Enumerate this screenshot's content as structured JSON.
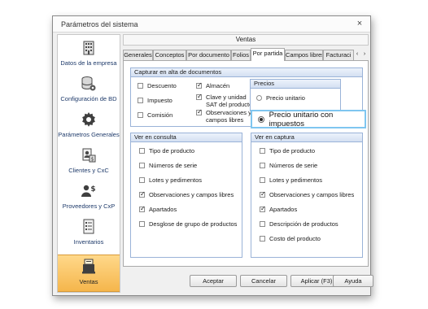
{
  "window": {
    "title": "Parámetros del sistema",
    "close": "×"
  },
  "sidebar": {
    "items": [
      {
        "label": "Datos de la empresa",
        "icon": "building-icon"
      },
      {
        "label": "Configuración de BD",
        "icon": "database-gear-icon"
      },
      {
        "label": "Parámetros Generales",
        "icon": "gear-icon"
      },
      {
        "label": "Clientes y CxC",
        "icon": "clients-document-icon"
      },
      {
        "label": "Proveedores y CxP",
        "icon": "supplier-money-icon"
      },
      {
        "label": "Inventarios",
        "icon": "inventory-list-icon"
      },
      {
        "label": "Ventas",
        "icon": "sales-register-icon",
        "active": true
      }
    ]
  },
  "header": {
    "title": "Ventas"
  },
  "tabs": {
    "items": [
      "Generales",
      "Conceptos",
      "Por documento",
      "Folios",
      "Por partida",
      "Campos libres",
      "Facturaci"
    ],
    "active": "Por partida",
    "prev": "‹",
    "next": "›"
  },
  "capturar": {
    "title": "Capturar en alta de documentos",
    "col1": [
      {
        "label": "Descuento",
        "checked": false
      },
      {
        "label": "Impuesto",
        "checked": false
      },
      {
        "label": "Comisión",
        "checked": false
      }
    ],
    "col2": [
      {
        "label": "Almacén",
        "checked": true
      },
      {
        "label": "Clave y unidad SAT del producto",
        "checked": true
      },
      {
        "label": "Observaciones y campos libres",
        "checked": true
      }
    ],
    "precios": {
      "title": "Precios",
      "options": [
        "Precio unitario",
        "Precio unitario con impuestos"
      ],
      "selected": "Precio unitario con impuestos"
    }
  },
  "consulta": {
    "title": "Ver en consulta",
    "items": [
      {
        "label": "Tipo de producto",
        "checked": false
      },
      {
        "label": "Números de serie",
        "checked": false
      },
      {
        "label": "Lotes y pedimentos",
        "checked": false
      },
      {
        "label": "Observaciones y campos libres",
        "checked": true
      },
      {
        "label": "Apartados",
        "checked": true
      },
      {
        "label": "Desglose de grupo de productos",
        "checked": false
      }
    ]
  },
  "captura": {
    "title": "Ver en captura",
    "items": [
      {
        "label": "Tipo de producto",
        "checked": false
      },
      {
        "label": "Números de serie",
        "checked": false
      },
      {
        "label": "Lotes y pedimentos",
        "checked": false
      },
      {
        "label": "Observaciones y campos libres",
        "checked": true
      },
      {
        "label": "Apartados",
        "checked": true
      },
      {
        "label": "Descripción de productos",
        "checked": false
      },
      {
        "label": "Costo del producto",
        "checked": false
      }
    ]
  },
  "buttons": {
    "accept": "Aceptar",
    "cancel": "Cancelar",
    "apply": "Aplicar (F3)",
    "help": "Ayuda"
  },
  "colors": {
    "accent_callout": "#7fc6f0",
    "active_sidebar": "#f5b64c",
    "group_header": "#d4e0f2"
  }
}
